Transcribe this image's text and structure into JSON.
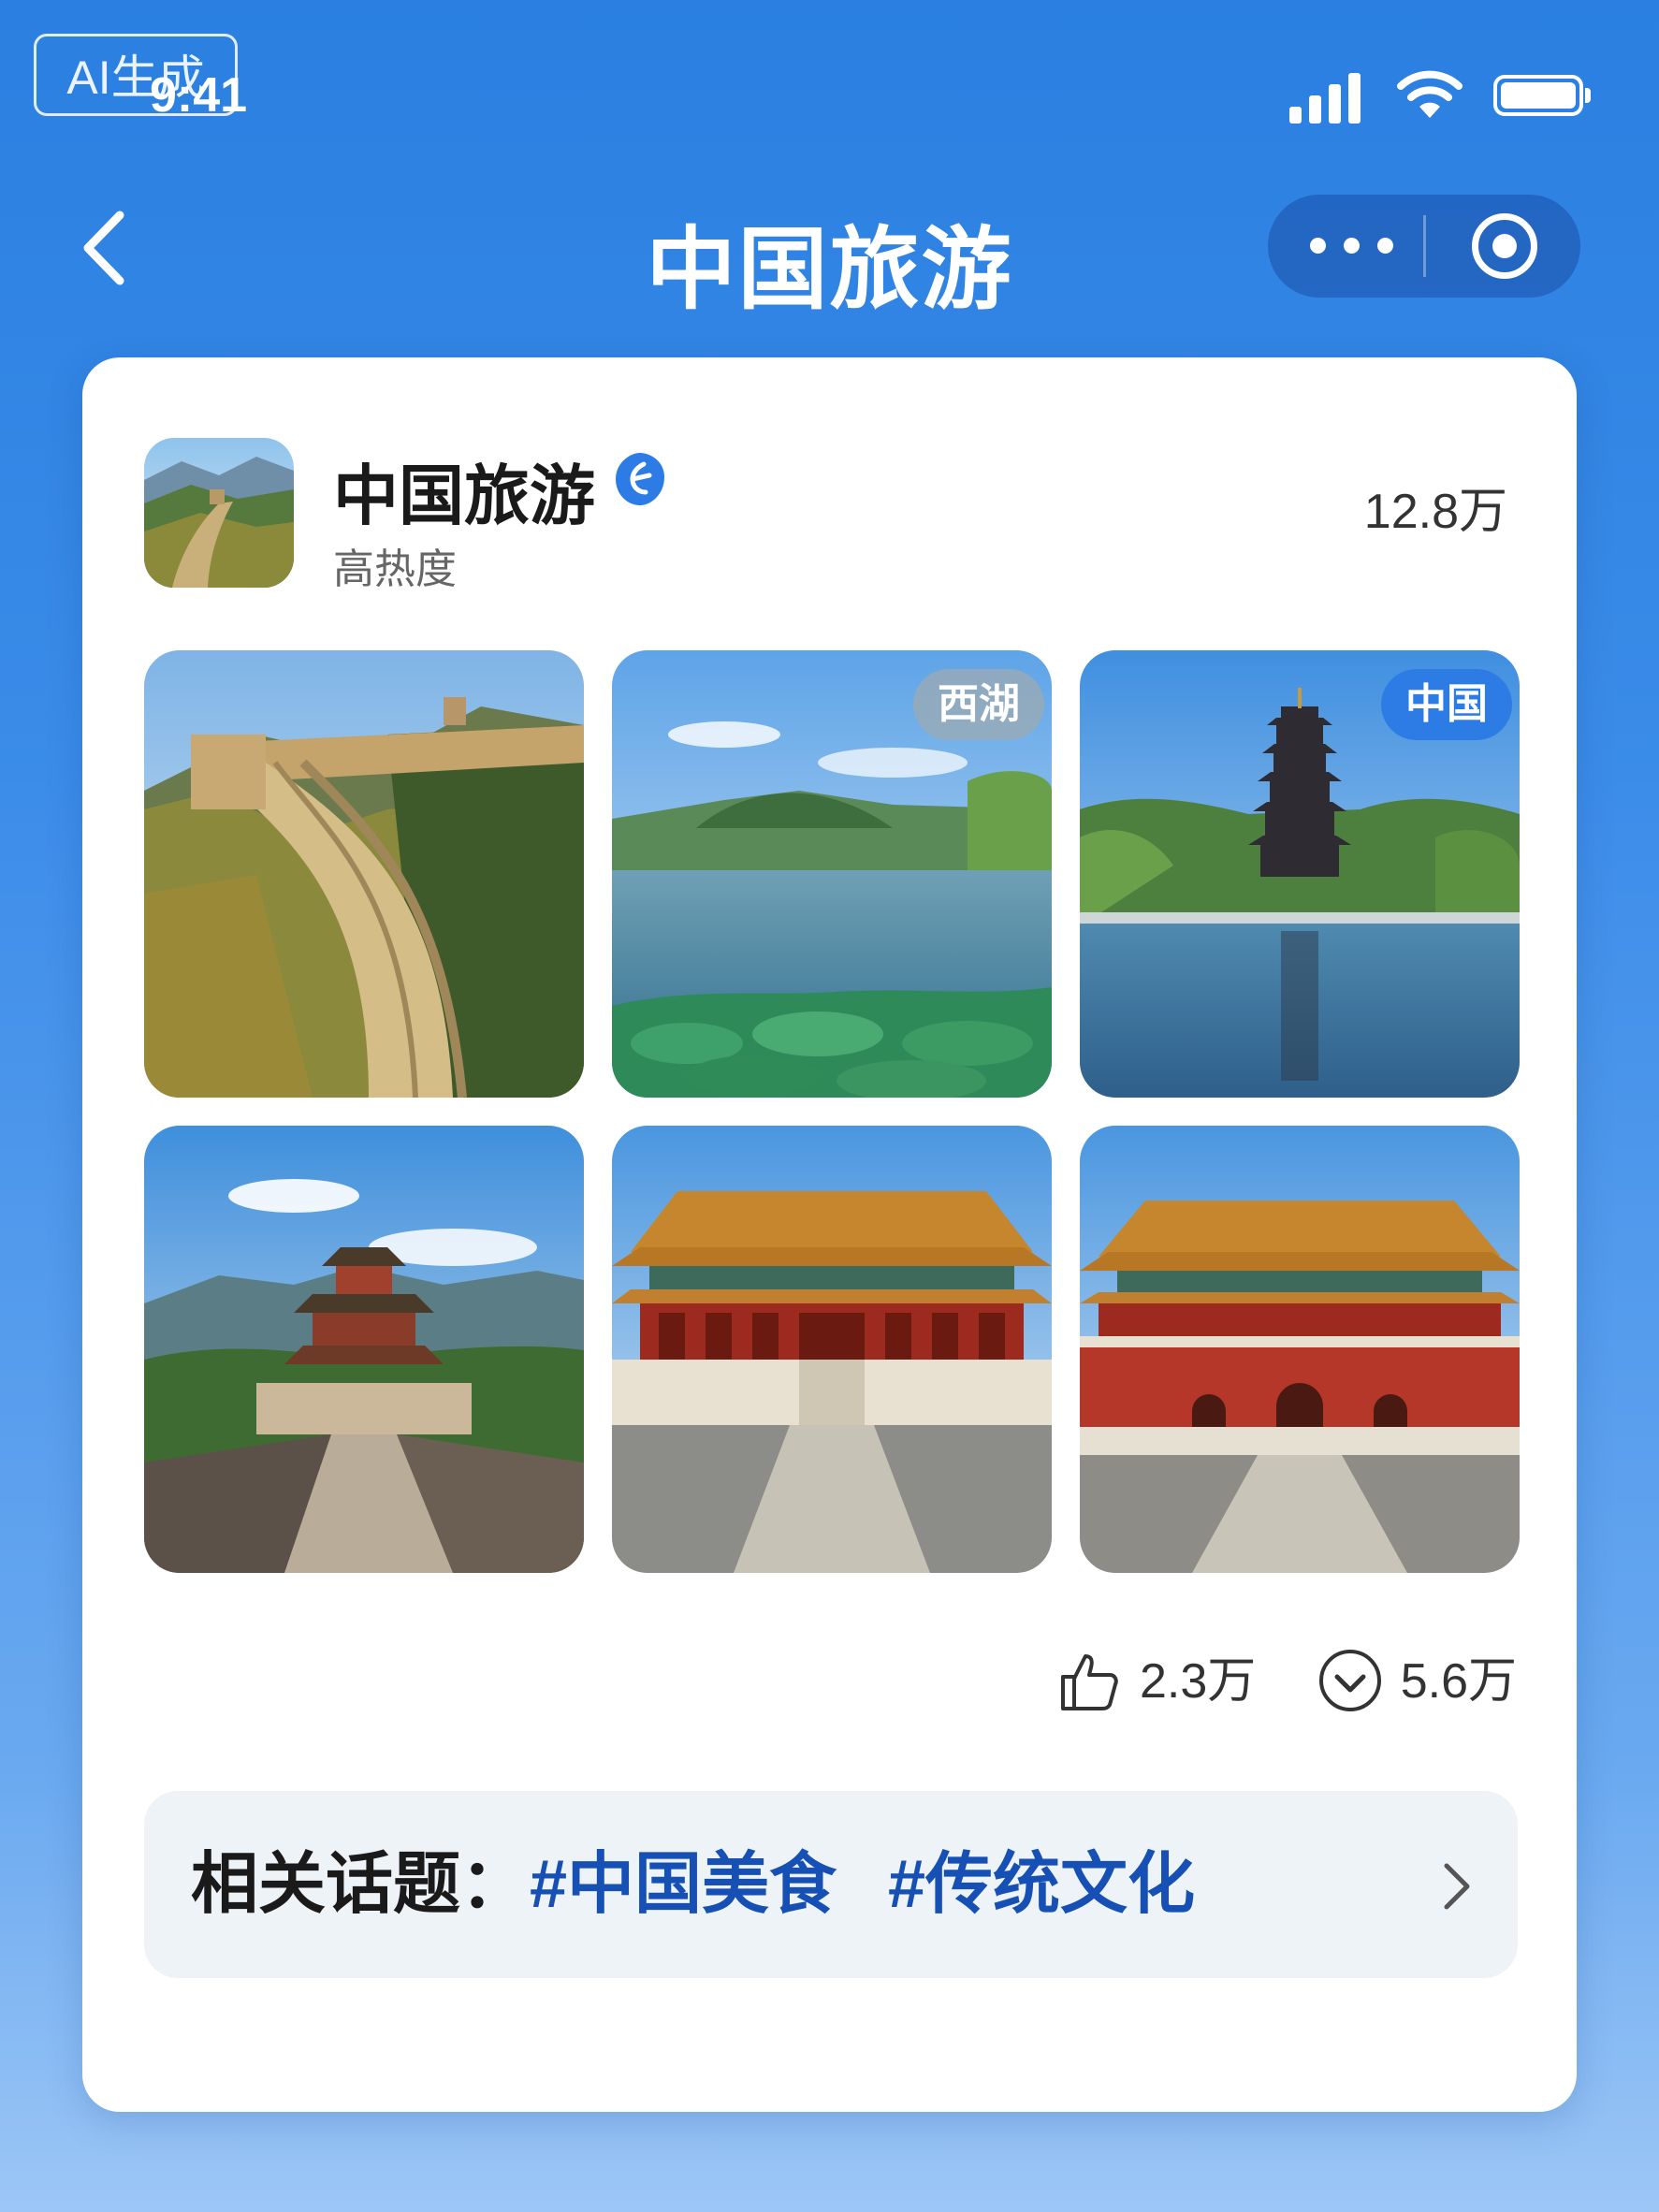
{
  "status_bar": {
    "ai_badge": "AI生成",
    "time": "9:41"
  },
  "nav": {
    "title": "中国旅游"
  },
  "account": {
    "name": "中国旅游",
    "subtitle": "高热度",
    "count": "12.8万"
  },
  "photos": [
    {
      "scene": "great-wall",
      "tag": ""
    },
    {
      "scene": "west-lake",
      "tag": "西湖"
    },
    {
      "scene": "pagoda-lake",
      "tag": "中国"
    },
    {
      "scene": "mountain-pavilion",
      "tag": ""
    },
    {
      "scene": "palace-hall",
      "tag": ""
    },
    {
      "scene": "palace-gate",
      "tag": ""
    }
  ],
  "stats": {
    "likes": "2.3万",
    "favorites": "5.6万"
  },
  "topics": {
    "label": "相关话题：",
    "tags": [
      "#中国美食",
      "#传统文化"
    ]
  },
  "colors": {
    "background": "#2a7fe0",
    "accent": "#2d7ce6",
    "topic_link": "#1650b5"
  }
}
